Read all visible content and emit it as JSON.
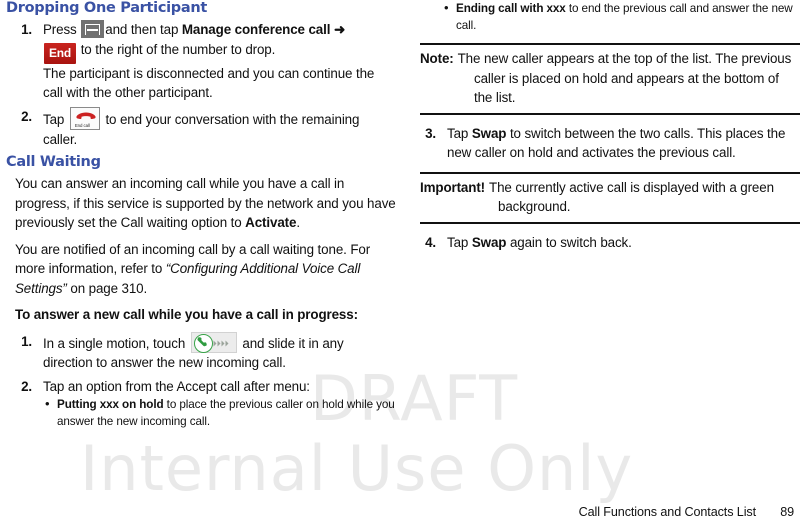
{
  "document": {
    "watermark": {
      "line1": "DRAFT",
      "line2": "Internal Use Only"
    },
    "footer": {
      "section_title": "Call Functions and Contacts List",
      "page_number": "89"
    },
    "colors": {
      "heading_blue": "#3a52a4",
      "end_button_red": "#b81914",
      "answer_green": "#38a348",
      "watermark_gray": "#e9e9e9"
    }
  },
  "left_column": {
    "heading": "Dropping One Participant",
    "step1": {
      "num": "1.",
      "text_a": "Press",
      "menu_icon_name": "menu-icon",
      "text_b": "and then tap",
      "bold_b": "Manage conference call",
      "arrow": "➜",
      "end_badge": "End",
      "text_c": "to the right of the number to drop.",
      "result": "The participant is disconnected and you can continue the call with the other participant."
    },
    "step2": {
      "num": "2.",
      "text_a": "Tap",
      "endcall_icon_name": "end-call-icon",
      "endcall_caption": "End call",
      "text_b": "to end your conversation with the remaining caller."
    },
    "heading2": "Call Waiting",
    "para1_a": "You can answer an incoming call while you have a call in progress, if this service is supported by the network and you have previously set the Call waiting option to ",
    "para1_bold": "Activate",
    "para1_b": ".",
    "para2_a": "You are notified of an incoming call by a call waiting tone. For more information, refer to ",
    "para2_italic": "“Configuring Additional Voice Call Settings”",
    "para2_b": " on page 310.",
    "lead": "To answer a new call while you have a call in progress:",
    "step3": {
      "num": "1.",
      "text_a": "In a single motion, touch",
      "answer_icon_name": "answer-call-slider-icon",
      "text_b": "and slide it in any direction to answer the new incoming call."
    },
    "step4": {
      "num": "2.",
      "text": "Tap an option from the Accept call after menu:"
    },
    "bullet1": {
      "bold": "Putting xxx on hold",
      "rest": " to place the previous caller on hold while you answer the new incoming call."
    }
  },
  "right_column": {
    "bullet1": {
      "bold": "Ending call with xxx",
      "rest": " to end the previous call and answer the new call."
    },
    "note": {
      "label": "Note:",
      "text": "The new caller appears at the top of the list. The previous caller is placed on hold and appears at the bottom of the list."
    },
    "step3": {
      "num": "3.",
      "text_a": "Tap ",
      "bold": "Swap",
      "text_b": " to switch between the two calls. This places the new caller on hold and activates the previous call."
    },
    "important": {
      "label": "Important!",
      "text": "The currently active call is displayed with a green background."
    },
    "step4": {
      "num": "4.",
      "text_a": "Tap ",
      "bold": "Swap",
      "text_b": " again to switch back."
    }
  }
}
